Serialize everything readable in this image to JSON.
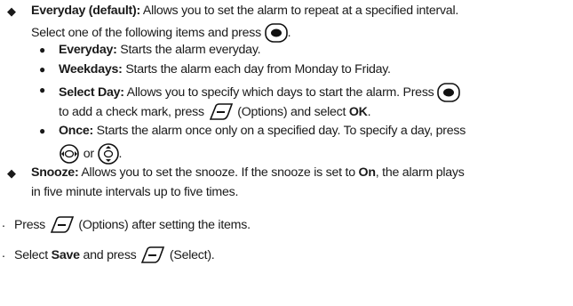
{
  "items": {
    "everyday_default": {
      "term": "Everyday (default):",
      "text1": " Allows you to set the alarm to repeat at a specified interval.",
      "text2": "Select one of the following items and press ",
      "text2_end": "."
    },
    "sub": [
      {
        "term": "Everyday:",
        "text": " Starts the alarm everyday."
      },
      {
        "term": "Weekdays:",
        "text": " Starts the alarm each day from Monday to Friday."
      },
      {
        "term": "Select Day:",
        "text": " Allows you to specify which days to start the alarm. Press ",
        "line2_a": "to add a check mark, press ",
        "line2_b": " (Options) and select ",
        "line2_ok": "OK",
        "line2_end": "."
      },
      {
        "term": "Once:",
        "text": " Starts the alarm once only on a specified day. To specify a day, press",
        "line2_or": " or ",
        "line2_end": "."
      }
    ],
    "snooze": {
      "term": "Snooze:",
      "text1": " Allows you to set the snooze. If the snooze is set to ",
      "on": "On",
      "text1_end": ", the alarm plays",
      "text2": "in five minute intervals up to five times."
    }
  },
  "steps": [
    {
      "num": ".",
      "a": "Press ",
      "b": " (Options) after setting the items."
    },
    {
      "num": ".",
      "a": "Select ",
      "save": "Save",
      "b": " and press ",
      "c": " (Select)."
    }
  ],
  "icons": {
    "center_key": "center-key-icon",
    "soft_key": "soft-key-icon",
    "nav_left_right": "nav-left-right-icon",
    "nav_up_down": "nav-up-down-icon"
  }
}
